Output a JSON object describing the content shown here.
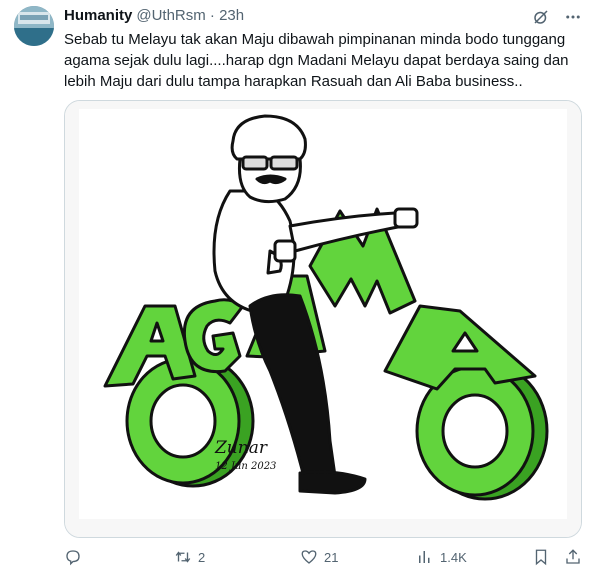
{
  "tweet": {
    "display_name": "Humanity",
    "handle": "@UthRsm",
    "separator": "·",
    "time": "23h",
    "text": "Sebab tu Melayu tak akan Maju dibawah pimpinanan minda bodo tunggang agama sejak dulu lagi....harap dgn Madani Melayu dapat berdaya saing dan lebih Maju dari dulu tampa harapkan Rasuah dan Ali Baba business..",
    "media": {
      "word": "AGAMA",
      "signature": "Zunar",
      "date_text": "12 Jun 2023"
    },
    "actions": {
      "reply_count": "",
      "retweet_count": "2",
      "like_count": "21",
      "view_count": "1.4K"
    }
  },
  "icons": [
    "grok-icon",
    "more-icon",
    "reply-icon",
    "retweet-icon",
    "like-icon",
    "views-icon",
    "bookmark-icon",
    "share-icon"
  ],
  "colors": {
    "accent_green": "#5fd33a",
    "muted": "#536471"
  }
}
